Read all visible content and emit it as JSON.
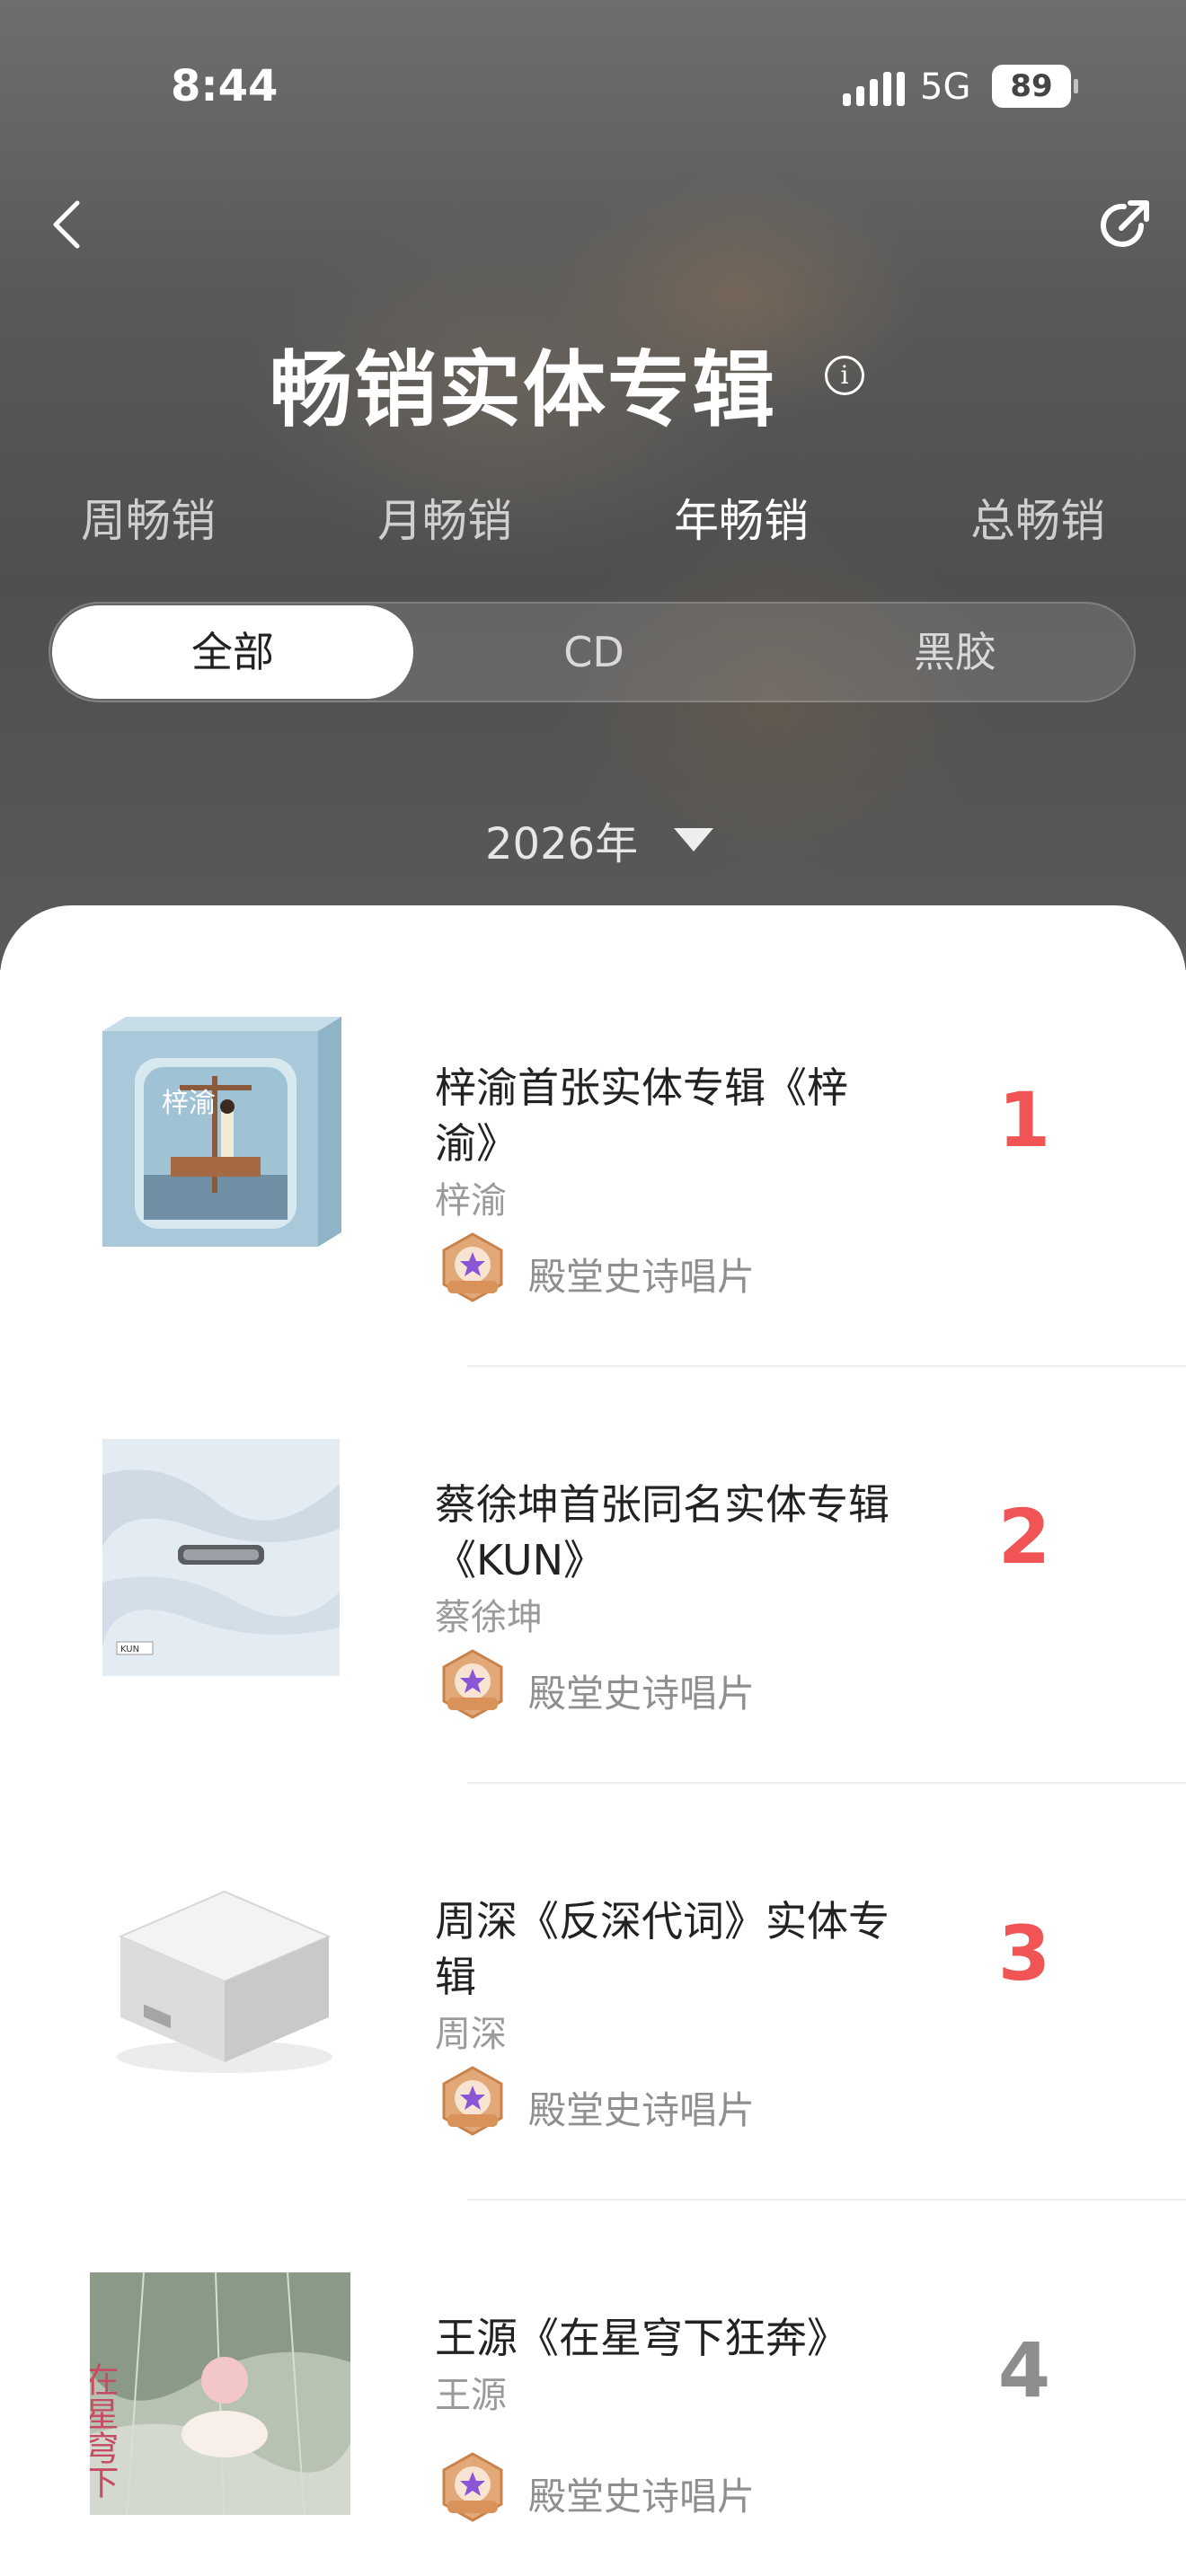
{
  "status": {
    "time": "8:44",
    "network": "5G",
    "battery": "89"
  },
  "header": {
    "title": "畅销实体专辑",
    "info_glyph": "i"
  },
  "period_tabs": [
    {
      "label": "周畅销",
      "active": false
    },
    {
      "label": "月畅销",
      "active": false
    },
    {
      "label": "年畅销",
      "active": true
    },
    {
      "label": "总畅销",
      "active": false
    }
  ],
  "format_filter": [
    {
      "label": "全部",
      "active": true
    },
    {
      "label": "CD",
      "active": false
    },
    {
      "label": "黑胶",
      "active": false
    }
  ],
  "year_selector": {
    "value": "2026年"
  },
  "albums": [
    {
      "rank": "1",
      "title": "梓渝首张实体专辑《梓渝》",
      "artist": "梓渝",
      "badge": "殿堂史诗唱片",
      "cover_text": "梓渝"
    },
    {
      "rank": "2",
      "title": "蔡徐坤首张同名实体专辑《KUN》",
      "artist": "蔡徐坤",
      "badge": "殿堂史诗唱片",
      "cover_text": "KUN"
    },
    {
      "rank": "3",
      "title": "周深《反深代词》实体专辑",
      "artist": "周深",
      "badge": "殿堂史诗唱片",
      "cover_text": ""
    },
    {
      "rank": "4",
      "title": "王源《在星穹下狂奔》",
      "artist": "王源",
      "badge": "殿堂史诗唱片",
      "cover_text": "在星穹下"
    }
  ],
  "colors": {
    "rank_top": "#f05454",
    "rank_other": "#8d8d8d",
    "badge_gold": "#d9935a",
    "badge_purple": "#8a55d6"
  }
}
